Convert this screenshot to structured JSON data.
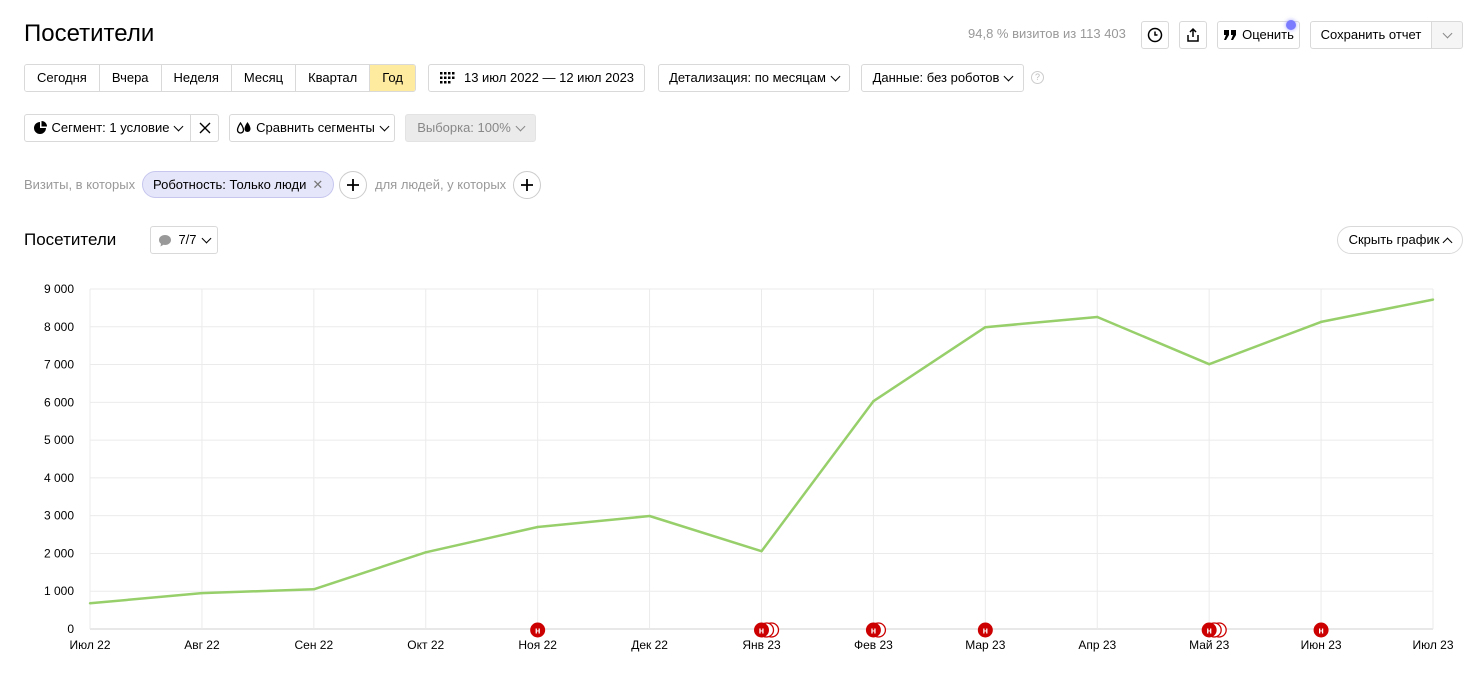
{
  "header": {
    "title": "Посетители",
    "visits_info": "94,8 % визитов из 113 403",
    "rate_label": "Оценить",
    "save_report_label": "Сохранить отчет"
  },
  "periods": [
    "Сегодня",
    "Вчера",
    "Неделя",
    "Месяц",
    "Квартал",
    "Год"
  ],
  "active_period": "Год",
  "date_range": "13 июл 2022 — 12 июл 2023",
  "detail_dropdown": "Детализация: по месяцам",
  "data_dropdown": "Данные: без роботов",
  "help_glyph": "?",
  "segment": {
    "label": "Сегмент: 1 условие",
    "compare_label": "Сравнить сегменты",
    "sample_label": "Выборка: 100%"
  },
  "filters": {
    "visits_label": "Визиты, в которых",
    "chip_label": "Роботность: Только люди",
    "people_label": "для людей, у которых"
  },
  "chart_section": {
    "title": "Посетители",
    "notes_count": "7/7",
    "hide_chart_label": "Скрыть график"
  },
  "colors": {
    "accent_yellow": "#ffeba0",
    "line": "#97cf6b",
    "marker": "#cc0000",
    "chip_bg": "#e6e6fb"
  },
  "chart_data": {
    "type": "line",
    "categories": [
      "Июл 22",
      "Авг 22",
      "Сен 22",
      "Окт 22",
      "Ноя 22",
      "Дек 22",
      "Янв 23",
      "Фев 23",
      "Мар 23",
      "Апр 23",
      "Май 23",
      "Июн 23",
      "Июл 23"
    ],
    "series": [
      {
        "values": [
          680,
          950,
          1050,
          2030,
          2700,
          2990,
          2060,
          6030,
          7990,
          8260,
          7010,
          8130,
          8720
        ]
      }
    ],
    "ylim": [
      0,
      9000
    ],
    "yticks": [
      0,
      1000,
      2000,
      3000,
      4000,
      5000,
      6000,
      7000,
      8000,
      9000
    ],
    "ytick_labels": [
      "0",
      "1 000",
      "2 000",
      "3 000",
      "4 000",
      "5 000",
      "6 000",
      "7 000",
      "8 000",
      "9 000"
    ],
    "grid": true,
    "annotations": [
      {
        "category": "Ноя 22",
        "label": "н",
        "count": 1
      },
      {
        "category": "Янв 23",
        "label": "н",
        "count": 3
      },
      {
        "category": "Фев 23",
        "label": "н",
        "count": 2
      },
      {
        "category": "Мар 23",
        "label": "н",
        "count": 1
      },
      {
        "category": "Май 23",
        "label": "н",
        "count": 3
      },
      {
        "category": "Июн 23",
        "label": "н",
        "count": 1
      }
    ]
  }
}
